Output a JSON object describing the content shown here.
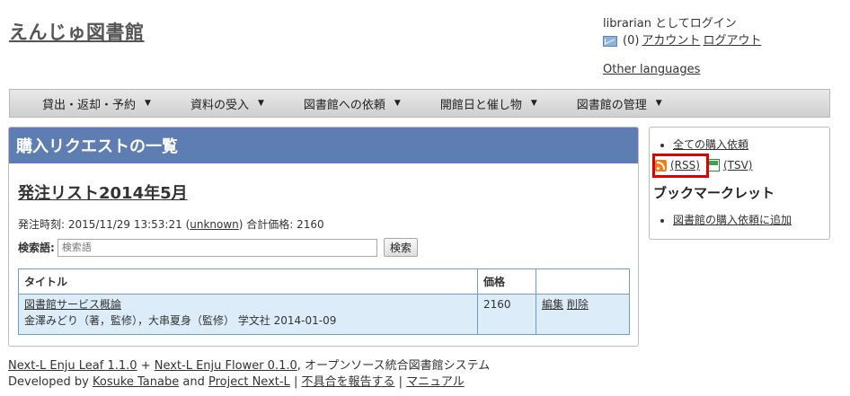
{
  "site": {
    "title": "えんじゅ図書館"
  },
  "user": {
    "login_status": "librarian としてログイン",
    "message_count": "(0)",
    "account_link": "アカウント",
    "logout_link": "ログアウト",
    "other_languages": "Other languages"
  },
  "nav": {
    "items": [
      {
        "label": "貸出・返却・予約"
      },
      {
        "label": "資料の受入"
      },
      {
        "label": "図書館への依頼"
      },
      {
        "label": "開館日と催し物"
      },
      {
        "label": "図書館の管理"
      }
    ],
    "caret": "▼"
  },
  "main": {
    "header": "購入リクエストの一覧",
    "order_title": "発注リスト2014年5月",
    "order_time_label": "発注時刻: ",
    "order_time": "2015/11/29 13:53:21",
    "order_user_open": "(",
    "order_user": "unknown",
    "order_user_close": ")",
    "total_label": " 合計価格: ",
    "total_value": "2160",
    "search_label": "検索語:",
    "search_placeholder": "検索語",
    "search_button": "検索",
    "table": {
      "headers": [
        "タイトル",
        "価格",
        ""
      ],
      "rows": [
        {
          "title": "図書館サービス概論",
          "detail": "金澤みどり（著，監修），大串夏身（監修） 学文社 2014-01-09",
          "price": "2160",
          "edit": "編集",
          "delete": "削除"
        }
      ]
    }
  },
  "sidebar": {
    "all_requests": "全ての購入依頼",
    "rss": "(RSS)",
    "tsv": "(TSV)",
    "bookmarklet_title": "ブックマークレット",
    "bookmarklet_link": "図書館の購入依頼に追加"
  },
  "footer": {
    "leaf": "Next-L Enju Leaf 1.1.0",
    "plus": " + ",
    "flower": "Next-L Enju Flower 0.1.0",
    "desc": ", オープンソース統合図書館システム",
    "developed_by": "Developed by ",
    "author": "Kosuke Tanabe",
    "and": " and ",
    "project": "Project Next-L",
    "sep": " | ",
    "report": "不具合を報告する",
    "manual": "マニュアル"
  },
  "colors": {
    "header_bg": "#5e7eb3",
    "highlight": "#e00000",
    "table_row_bg": "#dcedf9"
  }
}
